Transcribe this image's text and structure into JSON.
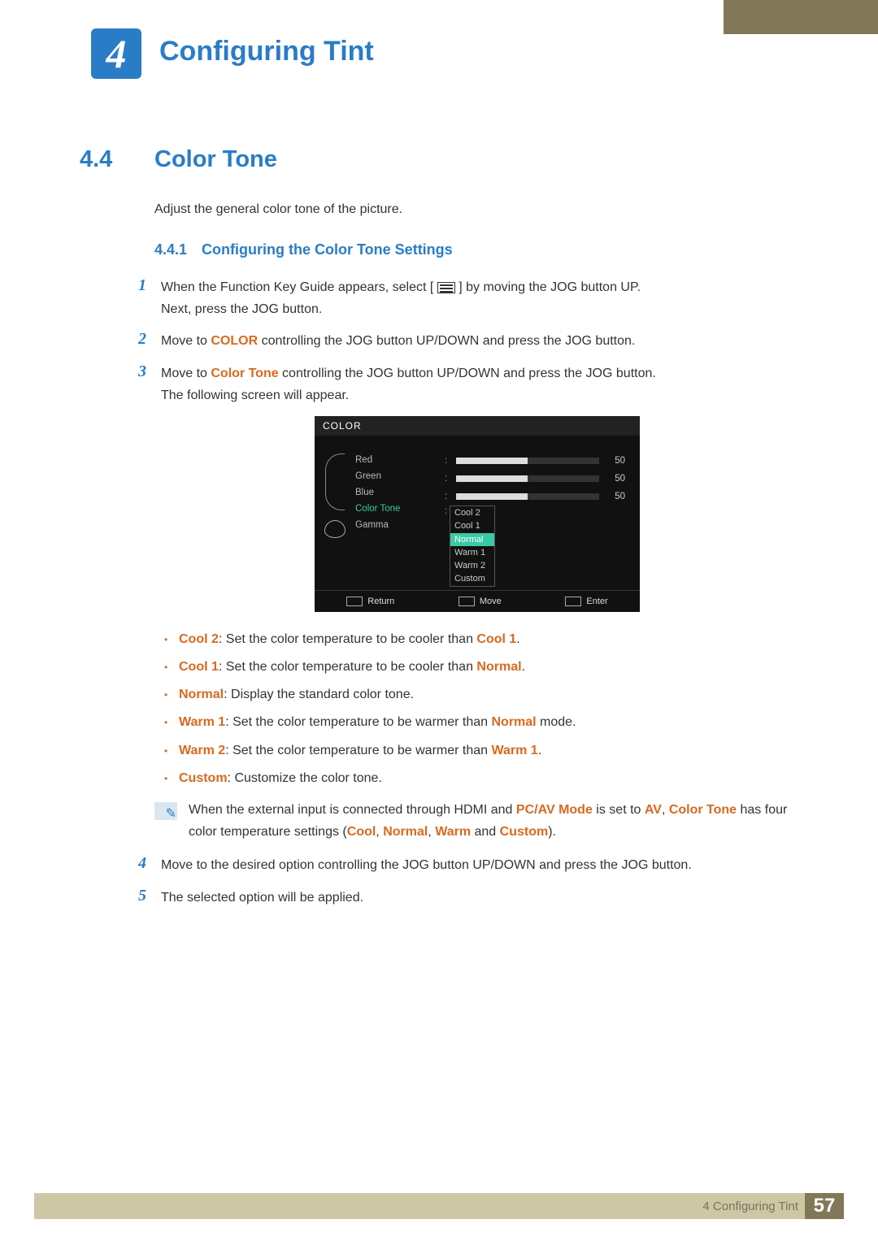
{
  "chapter": {
    "number": "4",
    "title": "Configuring Tint"
  },
  "section": {
    "number": "4.4",
    "title": "Color Tone",
    "intro": "Adjust the general color tone of the picture."
  },
  "subsection": {
    "number": "4.4.1",
    "title": "Configuring the Color Tone Settings"
  },
  "steps": {
    "s1a": "When the Function Key Guide appears, select [",
    "s1b": "] by moving the JOG button UP.",
    "s1c": "Next, press the JOG button.",
    "s2a": "Move to ",
    "s2_kw": "COLOR",
    "s2b": " controlling the JOG button UP/DOWN and press the JOG button.",
    "s3a": "Move to ",
    "s3_kw": "Color Tone",
    "s3b": " controlling the JOG button UP/DOWN and press the JOG button.",
    "s3c": "The following screen will appear.",
    "s4": "Move to the desired option controlling the JOG button UP/DOWN and press the JOG button.",
    "s5": "The selected option will be applied."
  },
  "osd": {
    "header": "COLOR",
    "items": {
      "red": "Red",
      "green": "Green",
      "blue": "Blue",
      "colortone": "Color Tone",
      "gamma": "Gamma"
    },
    "sliders": {
      "red": {
        "value": "50",
        "pct": 50
      },
      "green": {
        "value": "50",
        "pct": 50
      },
      "blue": {
        "value": "50",
        "pct": 50
      }
    },
    "options": [
      "Cool 2",
      "Cool 1",
      "Normal",
      "Warm 1",
      "Warm 2",
      "Custom"
    ],
    "selected_index": 2,
    "footer": {
      "return": "Return",
      "move": "Move",
      "enter": "Enter"
    }
  },
  "bullets": {
    "cool2": {
      "label": "Cool 2",
      "text": ": Set the color temperature to be cooler than ",
      "ref": "Cool 1",
      "tail": "."
    },
    "cool1": {
      "label": "Cool 1",
      "text": ": Set the color temperature to be cooler than ",
      "ref": "Normal",
      "tail": "."
    },
    "normal": {
      "label": "Normal",
      "text": ": Display the standard color tone."
    },
    "warm1": {
      "label": "Warm 1",
      "text": ": Set the color temperature to be warmer than ",
      "ref": "Normal",
      "tail": " mode."
    },
    "warm2": {
      "label": "Warm 2",
      "text": ": Set the color temperature to be warmer than ",
      "ref": "Warm 1",
      "tail": "."
    },
    "custom": {
      "label": "Custom",
      "text": ": Customize the color tone."
    }
  },
  "note": {
    "t1": "When the external input is connected through HDMI and ",
    "k1": "PC/AV Mode",
    "t2": " is set to ",
    "k2": "AV",
    "t3": ", ",
    "k3": "Color Tone",
    "t4": " has four color temperature settings (",
    "o1": "Cool",
    "c1": ", ",
    "o2": "Normal",
    "c2": ", ",
    "o3": "Warm",
    "c3": " and ",
    "o4": "Custom",
    "t5": ")."
  },
  "footer": {
    "chapter_ref": "4 Configuring Tint",
    "page": "57"
  }
}
